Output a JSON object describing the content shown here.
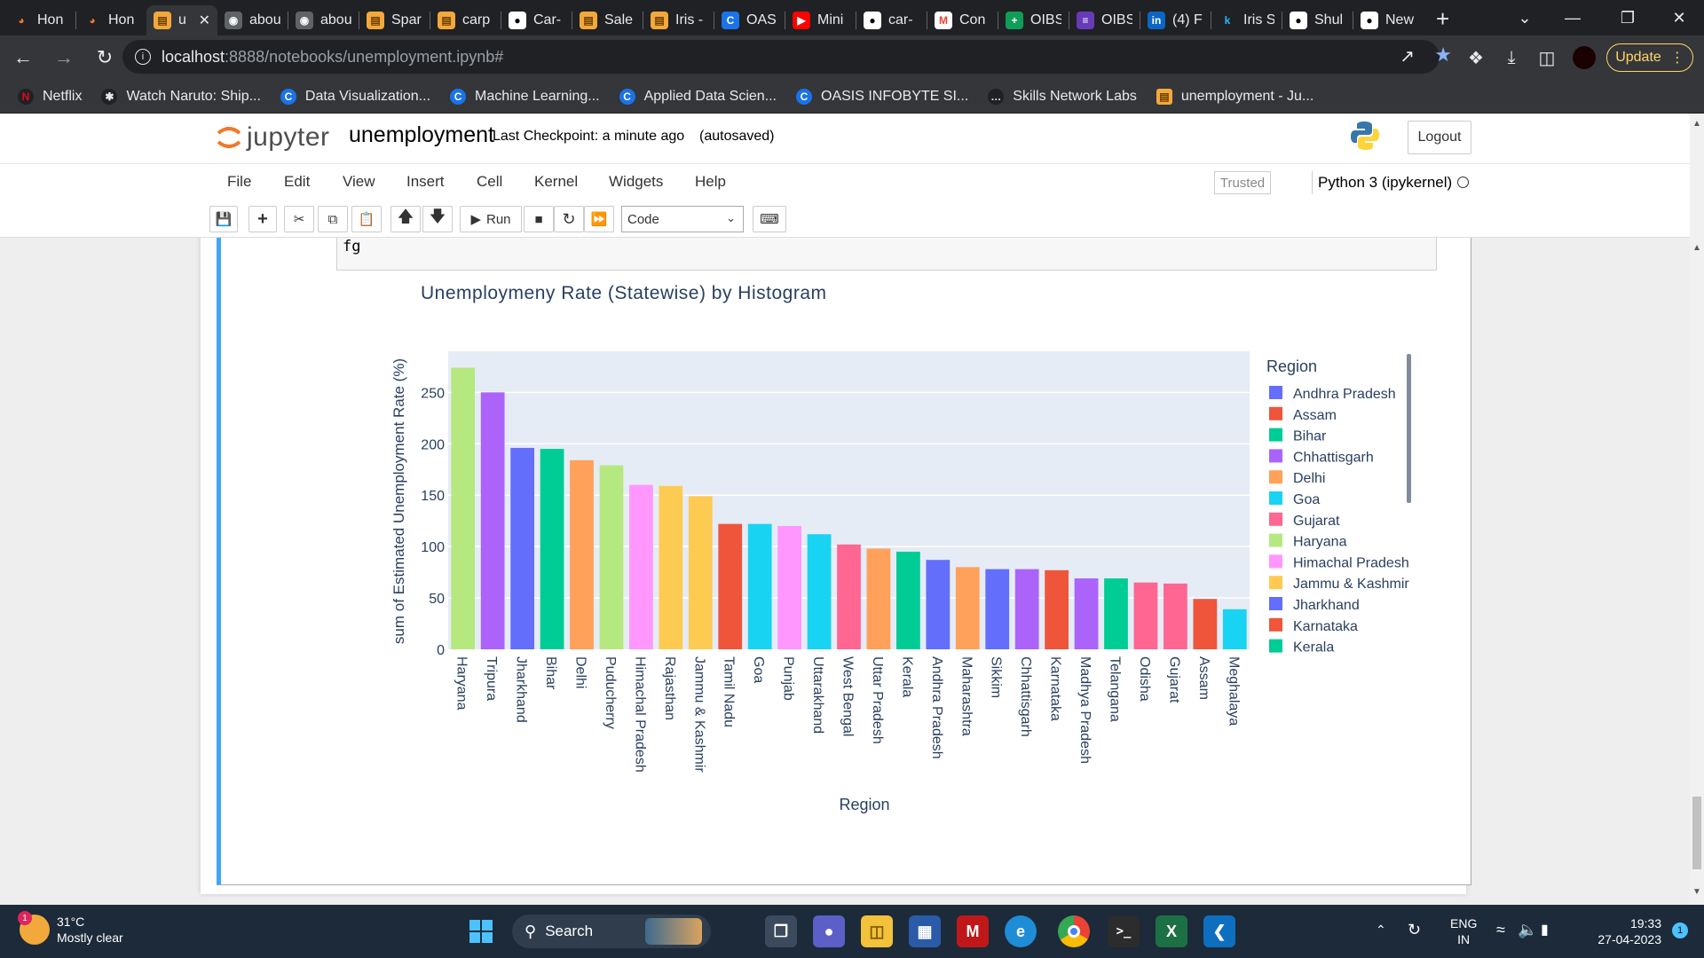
{
  "browser": {
    "tabs": [
      {
        "label": "Hon",
        "icon": "jupyter-icon"
      },
      {
        "label": "Hon",
        "icon": "jupyter-icon"
      },
      {
        "label": "u",
        "icon": "notebook-icon",
        "active": true
      },
      {
        "label": "abou",
        "icon": "globe-icon"
      },
      {
        "label": "abou",
        "icon": "globe-icon"
      },
      {
        "label": "Spar",
        "icon": "notebook-icon"
      },
      {
        "label": "carp",
        "icon": "notebook-icon"
      },
      {
        "label": "Car-",
        "icon": "github-icon"
      },
      {
        "label": "Sale",
        "icon": "notebook-icon"
      },
      {
        "label": "Iris -",
        "icon": "notebook-icon"
      },
      {
        "label": "OAS",
        "icon": "oasis-icon"
      },
      {
        "label": "Mini",
        "icon": "youtube-icon"
      },
      {
        "label": "car-",
        "icon": "github-icon"
      },
      {
        "label": "Con",
        "icon": "gmail-icon"
      },
      {
        "label": "OIBS",
        "icon": "sheets-icon"
      },
      {
        "label": "OIBS",
        "icon": "forms-icon"
      },
      {
        "label": "(4) F",
        "icon": "linkedin-icon"
      },
      {
        "label": "Iris S",
        "icon": "kaggle-icon"
      },
      {
        "label": "Shul",
        "icon": "github-icon"
      },
      {
        "label": "New",
        "icon": "github-icon"
      }
    ],
    "url_host": "localhost",
    "url_path": ":8888/notebooks/unemployment.ipynb#",
    "update_label": "Update",
    "bookmarks": [
      {
        "label": "Netflix",
        "icon": "netflix-icon"
      },
      {
        "label": "Watch Naruto: Ship...",
        "icon": "naruto-icon"
      },
      {
        "label": "Data Visualization...",
        "icon": "coursera-icon"
      },
      {
        "label": "Machine Learning...",
        "icon": "coursera-icon"
      },
      {
        "label": "Applied Data Scien...",
        "icon": "coursera-icon"
      },
      {
        "label": "OASIS INFOBYTE SI...",
        "icon": "oasis-icon"
      },
      {
        "label": "Skills Network Labs",
        "icon": "skills-network-icon"
      },
      {
        "label": "unemployment - Ju...",
        "icon": "notebook-icon"
      }
    ]
  },
  "jupyter": {
    "logo_text": "jupyter",
    "notebook_name": "unemployment",
    "checkpoint": "Last Checkpoint: a minute ago",
    "autosave": "(autosaved)",
    "logout_label": "Logout",
    "menu": [
      "File",
      "Edit",
      "View",
      "Insert",
      "Cell",
      "Kernel",
      "Widgets",
      "Help"
    ],
    "trusted_label": "Trusted",
    "kernel_name": "Python 3 (ipykernel)",
    "run_label": "Run",
    "cell_type": "Code",
    "code_line": "fg"
  },
  "chart_data": {
    "type": "bar",
    "title": "Unemploymeny Rate (Statewise) by Histogram",
    "xlabel": "Region",
    "ylabel": "sum of Estimated Unemployment Rate (%)",
    "ylim": [
      0,
      290
    ],
    "yticks": [
      0,
      50,
      100,
      150,
      200,
      250
    ],
    "grid": true,
    "legend_title": "Region",
    "legend_placement": "right",
    "categories": [
      "Haryana",
      "Tripura",
      "Jharkhand",
      "Bihar",
      "Delhi",
      "Puducherry",
      "Himachal Pradesh",
      "Rajasthan",
      "Jammu & Kashmir",
      "Tamil Nadu",
      "Goa",
      "Punjab",
      "Uttarakhand",
      "West Bengal",
      "Uttar Pradesh",
      "Kerala",
      "Andhra Pradesh",
      "Maharashtra",
      "Sikkim",
      "Chhattisgarh",
      "Karnataka",
      "Madhya Pradesh",
      "Telangana",
      "Odisha",
      "Gujarat",
      "Assam",
      "Meghalaya"
    ],
    "values": [
      274,
      250,
      196,
      195,
      184,
      179,
      160,
      159,
      149,
      122,
      122,
      120,
      112,
      102,
      98,
      95,
      87,
      80,
      78,
      78,
      77,
      69,
      69,
      65,
      64,
      49,
      39
    ],
    "colors": [
      "#B6E880",
      "#AB63FA",
      "#636EFA",
      "#00CC96",
      "#FFA15A",
      "#B6E880",
      "#FF97FF",
      "#FECB52",
      "#FECB52",
      "#EF553B",
      "#19D3F3",
      "#FF97FF",
      "#19D3F3",
      "#FF6692",
      "#FFA15A",
      "#00CC96",
      "#636EFA",
      "#FFA15A",
      "#636EFA",
      "#AB63FA",
      "#EF553B",
      "#AB63FA",
      "#00CC96",
      "#FF6692",
      "#FF6692",
      "#EF553B",
      "#19D3F3"
    ],
    "legend": [
      {
        "name": "Andhra Pradesh",
        "color": "#636EFA"
      },
      {
        "name": "Assam",
        "color": "#EF553B"
      },
      {
        "name": "Bihar",
        "color": "#00CC96"
      },
      {
        "name": "Chhattisgarh",
        "color": "#AB63FA"
      },
      {
        "name": "Delhi",
        "color": "#FFA15A"
      },
      {
        "name": "Goa",
        "color": "#19D3F3"
      },
      {
        "name": "Gujarat",
        "color": "#FF6692"
      },
      {
        "name": "Haryana",
        "color": "#B6E880"
      },
      {
        "name": "Himachal Pradesh",
        "color": "#FF97FF"
      },
      {
        "name": "Jammu & Kashmir",
        "color": "#FECB52"
      },
      {
        "name": "Jharkhand",
        "color": "#636EFA"
      },
      {
        "name": "Karnataka",
        "color": "#EF553B"
      },
      {
        "name": "Kerala",
        "color": "#00CC96"
      }
    ]
  },
  "taskbar": {
    "temperature": "31°C",
    "weather": "Mostly clear",
    "weather_badge": "1",
    "search_label": "Search",
    "lang": "ENG",
    "region": "IN",
    "time": "19:33",
    "date": "27-04-2023",
    "notif_count": "1"
  }
}
